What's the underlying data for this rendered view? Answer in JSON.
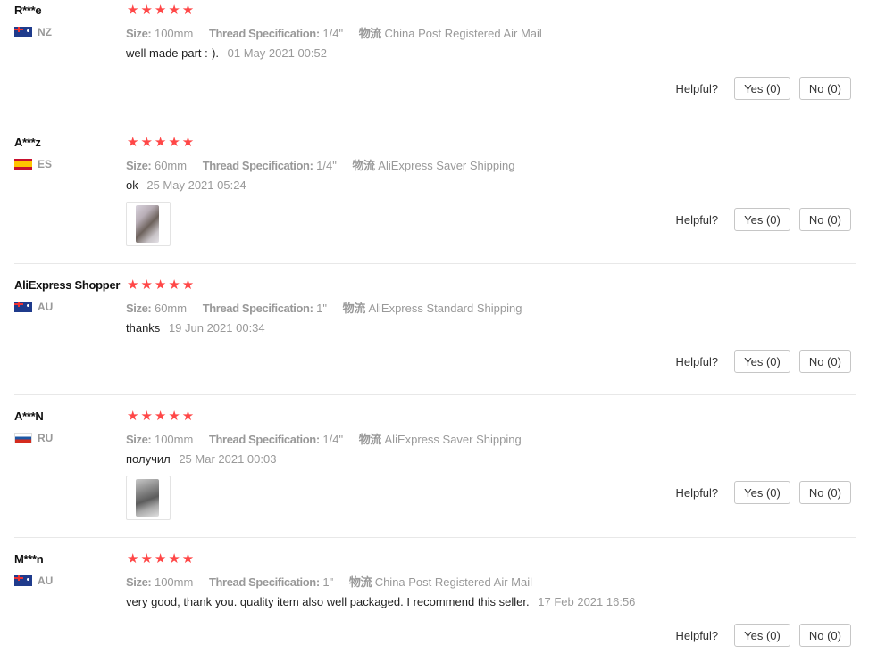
{
  "reviews": [
    {
      "user": "R***e",
      "country_code": "NZ",
      "flag_icon": "nz-flag-icon",
      "stars": "★★★★★",
      "rating": 5,
      "specs": [
        {
          "label": "Size:",
          "value": "100mm"
        },
        {
          "label": "Thread Specification:",
          "value": "1/4\""
        },
        {
          "label": "物流",
          "value": "China Post Registered Air Mail"
        }
      ],
      "comment": "well made part :-).",
      "date": "01 May 2021 00:52",
      "helpful_label": "Helpful?",
      "yes_label": "Yes (0)",
      "no_label": "No (0)"
    },
    {
      "user": "A***z",
      "country_code": "ES",
      "flag_icon": "es-flag-icon",
      "stars": "★★★★★",
      "rating": 5,
      "specs": [
        {
          "label": "Size:",
          "value": "60mm"
        },
        {
          "label": "Thread Specification:",
          "value": "1/4\""
        },
        {
          "label": "物流",
          "value": "AliExpress Saver Shipping"
        }
      ],
      "comment": "ok",
      "date": "25 May 2021 05:24",
      "helpful_label": "Helpful?",
      "yes_label": "Yes (0)",
      "no_label": "No (0)"
    },
    {
      "user": "AliExpress Shopper",
      "country_code": "AU",
      "flag_icon": "au-flag-icon",
      "stars": "★★★★★",
      "rating": 5,
      "specs": [
        {
          "label": "Size:",
          "value": "60mm"
        },
        {
          "label": "Thread Specification:",
          "value": "1\""
        },
        {
          "label": "物流",
          "value": "AliExpress Standard Shipping"
        }
      ],
      "comment": "thanks",
      "date": "19 Jun 2021 00:34",
      "helpful_label": "Helpful?",
      "yes_label": "Yes (0)",
      "no_label": "No (0)"
    },
    {
      "user": "A***N",
      "country_code": "RU",
      "flag_icon": "ru-flag-icon",
      "stars": "★★★★★",
      "rating": 5,
      "specs": [
        {
          "label": "Size:",
          "value": "100mm"
        },
        {
          "label": "Thread Specification:",
          "value": "1/4\""
        },
        {
          "label": "物流",
          "value": "AliExpress Saver Shipping"
        }
      ],
      "comment": "получил",
      "date": "25 Mar 2021 00:03",
      "helpful_label": "Helpful?",
      "yes_label": "Yes (0)",
      "no_label": "No (0)"
    },
    {
      "user": "M***n",
      "country_code": "AU",
      "flag_icon": "au-flag-icon",
      "stars": "★★★★★",
      "rating": 5,
      "specs": [
        {
          "label": "Size:",
          "value": "100mm"
        },
        {
          "label": "Thread Specification:",
          "value": "1\""
        },
        {
          "label": "物流",
          "value": "China Post Registered Air Mail"
        }
      ],
      "comment": "very good, thank you. quality item also well packaged. I recommend this seller.",
      "date": "17 Feb 2021 16:56",
      "helpful_label": "Helpful?",
      "yes_label": "Yes (0)",
      "no_label": "No (0)"
    }
  ],
  "colors": {
    "star": "#ff4747",
    "muted_text": "#999999",
    "divider": "#e8e8e8"
  }
}
